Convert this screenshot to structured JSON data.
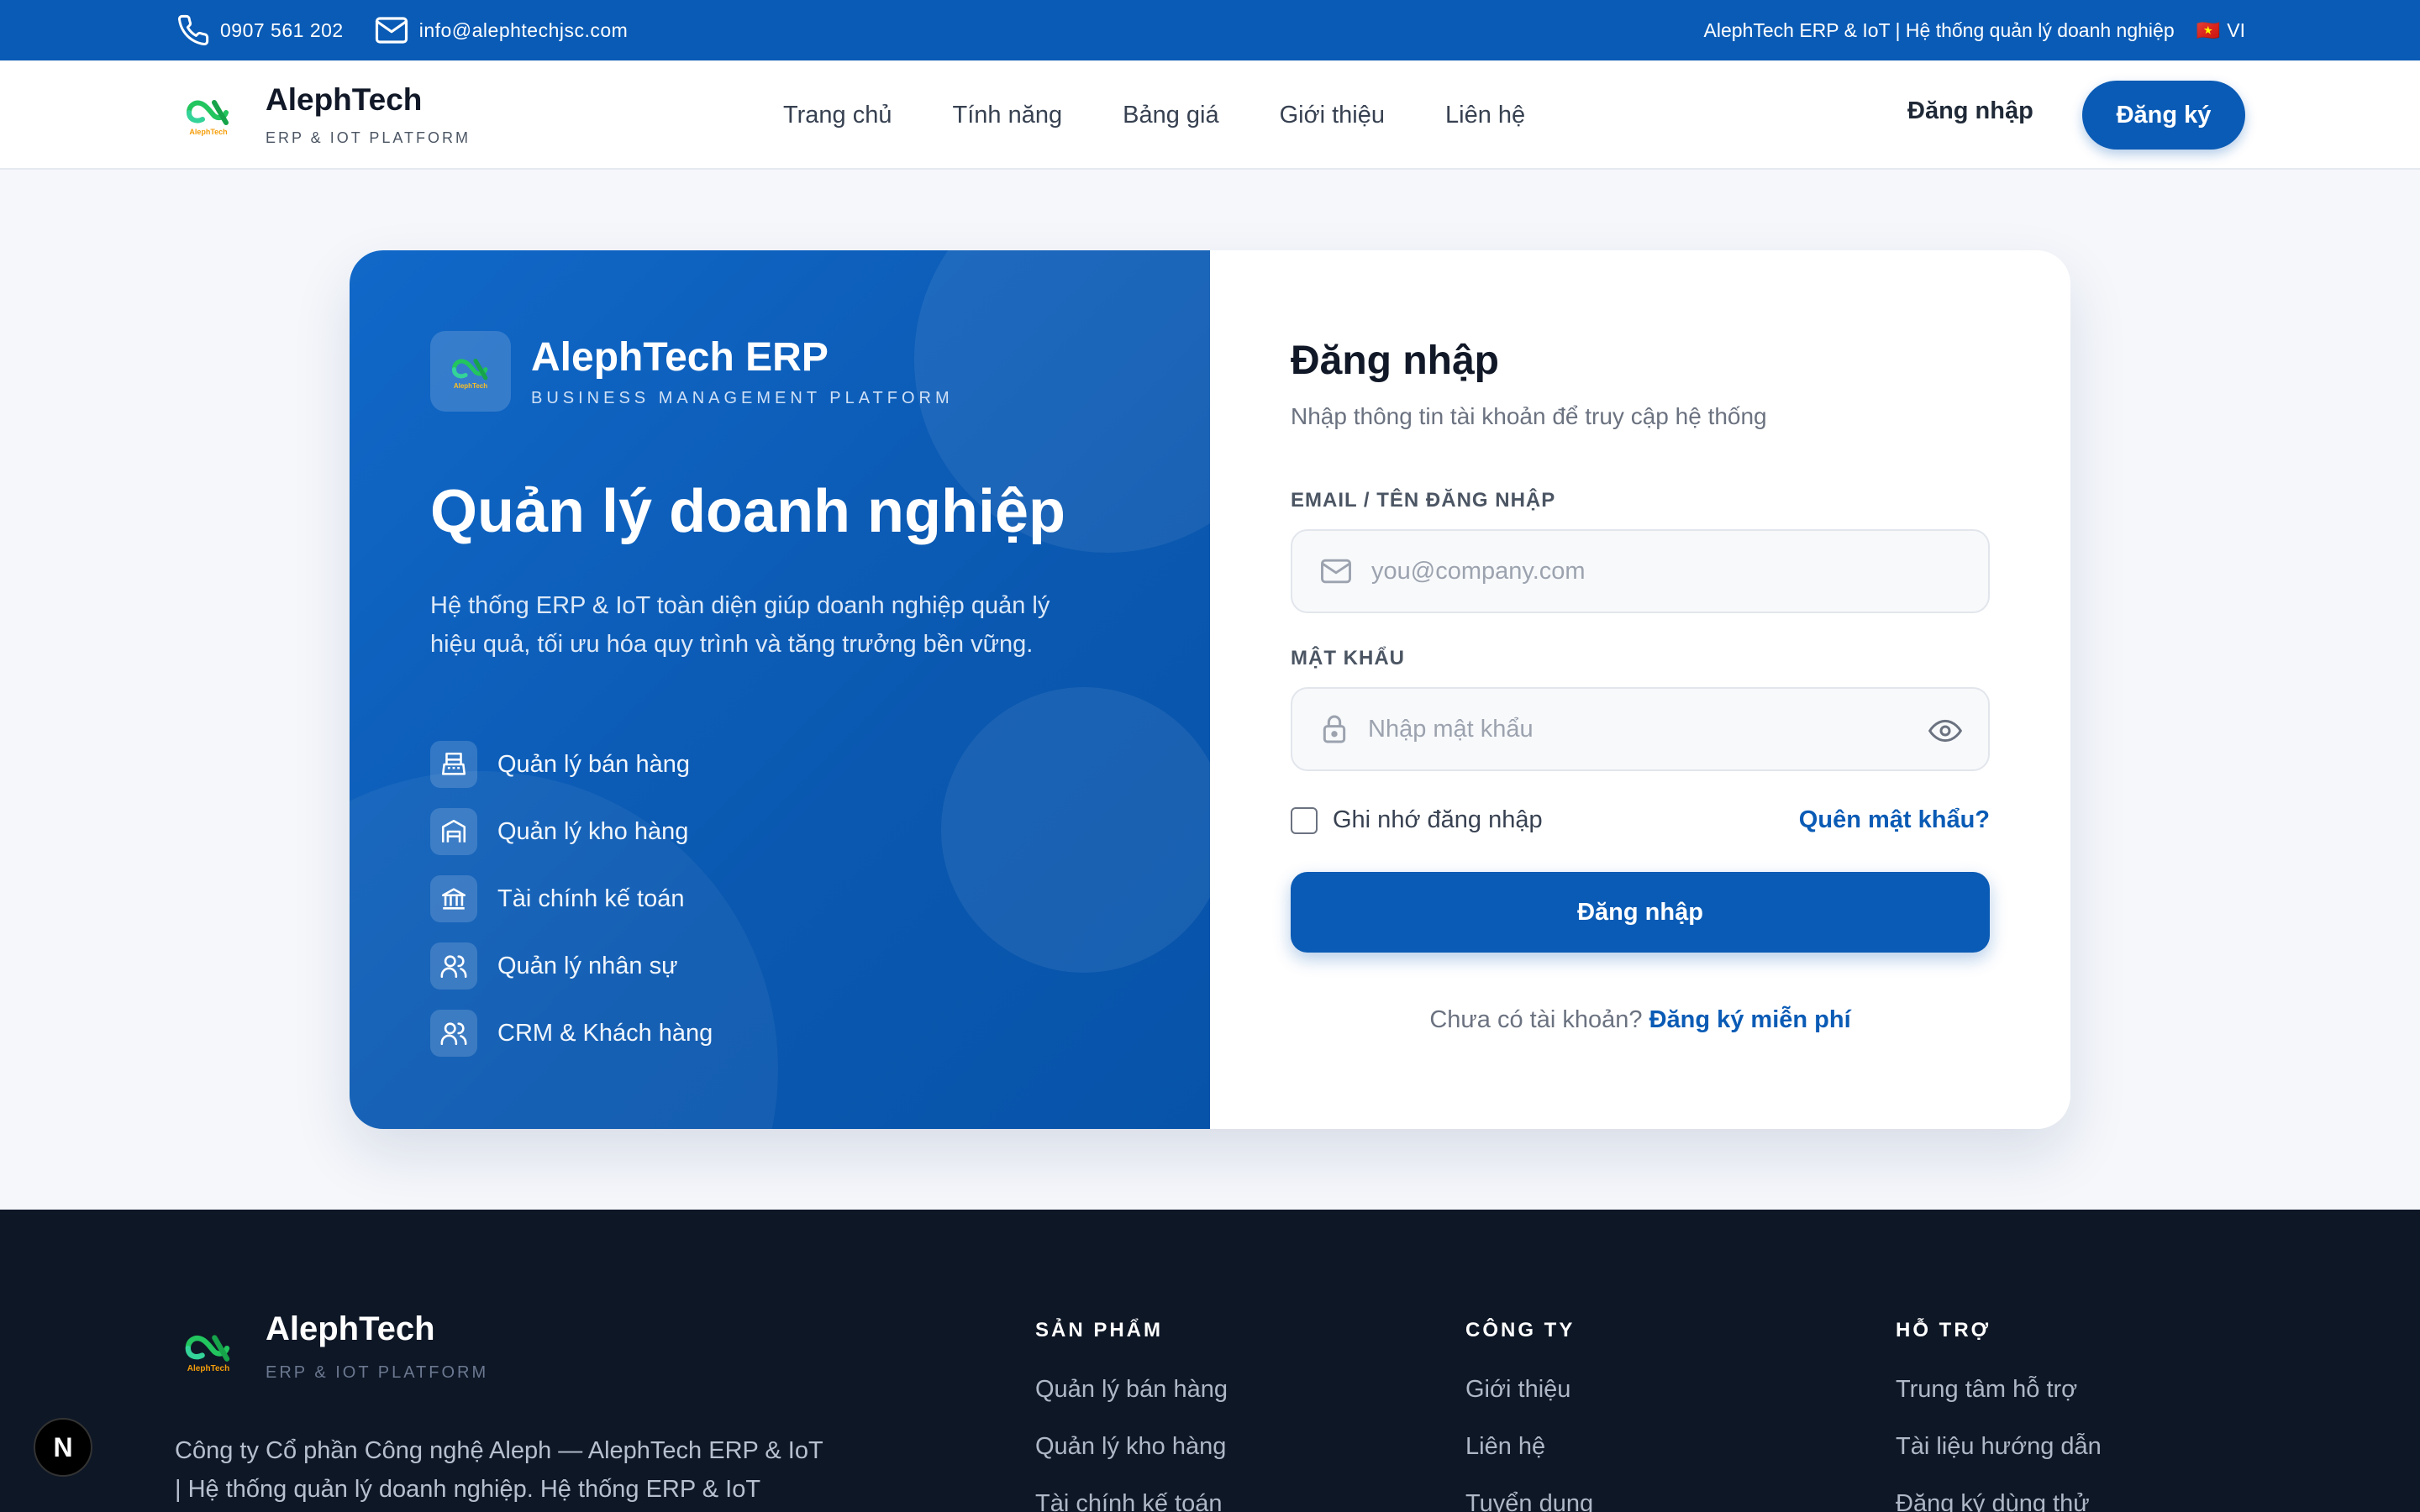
{
  "topbar": {
    "phone": "0907 561 202",
    "email": "info@alephtechjsc.com",
    "tagline": "AlephTech ERP & IoT | Hệ thống quản lý doanh nghiệp",
    "language": "VI",
    "language_flag": "🇻🇳"
  },
  "header": {
    "brand_name": "AlephTech",
    "brand_sub": "ERP & IOT PLATFORM",
    "nav": [
      "Trang chủ",
      "Tính năng",
      "Bảng giá",
      "Giới thiệu",
      "Liên hệ"
    ],
    "login_label": "Đăng nhập",
    "signup_label": "Đăng ký"
  },
  "logo": {
    "text": "AlephTech"
  },
  "promo": {
    "brand_name": "AlephTech ERP",
    "brand_sub": "BUSINESS MANAGEMENT PLATFORM",
    "title": "Quản lý doanh nghiệp",
    "description": "Hệ thống ERP & IoT toàn diện giúp doanh nghiệp quản lý hiệu quả, tối ưu hóa quy trình và tăng trưởng bền vững.",
    "features": [
      {
        "label": "Quản lý bán hàng",
        "icon": "cash-register-icon"
      },
      {
        "label": "Quản lý kho hàng",
        "icon": "warehouse-icon"
      },
      {
        "label": "Tài chính kế toán",
        "icon": "bank-icon"
      },
      {
        "label": "Quản lý nhân sự",
        "icon": "users-icon"
      },
      {
        "label": "CRM & Khách hàng",
        "icon": "users-icon"
      }
    ]
  },
  "login_form": {
    "title": "Đăng nhập",
    "subtitle": "Nhập thông tin tài khoản để truy cập hệ thống",
    "email_label": "EMAIL / TÊN ĐĂNG NHẬP",
    "email_placeholder": "you@company.com",
    "email_value": "",
    "password_label": "MẬT KHẨU",
    "password_placeholder": "Nhập mật khẩu",
    "password_value": "",
    "remember_label": "Ghi nhớ đăng nhập",
    "forgot_label": "Quên mật khẩu?",
    "submit_label": "Đăng nhập",
    "no_account": "Chưa có tài khoản?",
    "signup_link": "Đăng ký miễn phí"
  },
  "footer": {
    "brand_name": "AlephTech",
    "brand_sub": "ERP & IOT PLATFORM",
    "description": "Công ty Cổ phần Công nghệ Aleph — AlephTech ERP & IoT | Hệ thống quản lý doanh nghiệp. Hệ thống ERP & IoT",
    "columns": [
      {
        "title": "SẢN PHẨM",
        "links": [
          "Quản lý bán hàng",
          "Quản lý kho hàng",
          "Tài chính kế toán"
        ]
      },
      {
        "title": "CÔNG TY",
        "links": [
          "Giới thiệu",
          "Liên hệ",
          "Tuyển dụng"
        ]
      },
      {
        "title": "HỖ TRỢ",
        "links": [
          "Trung tâm hỗ trợ",
          "Tài liệu hướng dẫn",
          "Đăng ký dùng thử"
        ]
      }
    ]
  },
  "dev_badge": "N",
  "colors": {
    "primary": "#0a5bb5",
    "footer_bg": "#0e1726",
    "logo_green": "#22c55e"
  }
}
